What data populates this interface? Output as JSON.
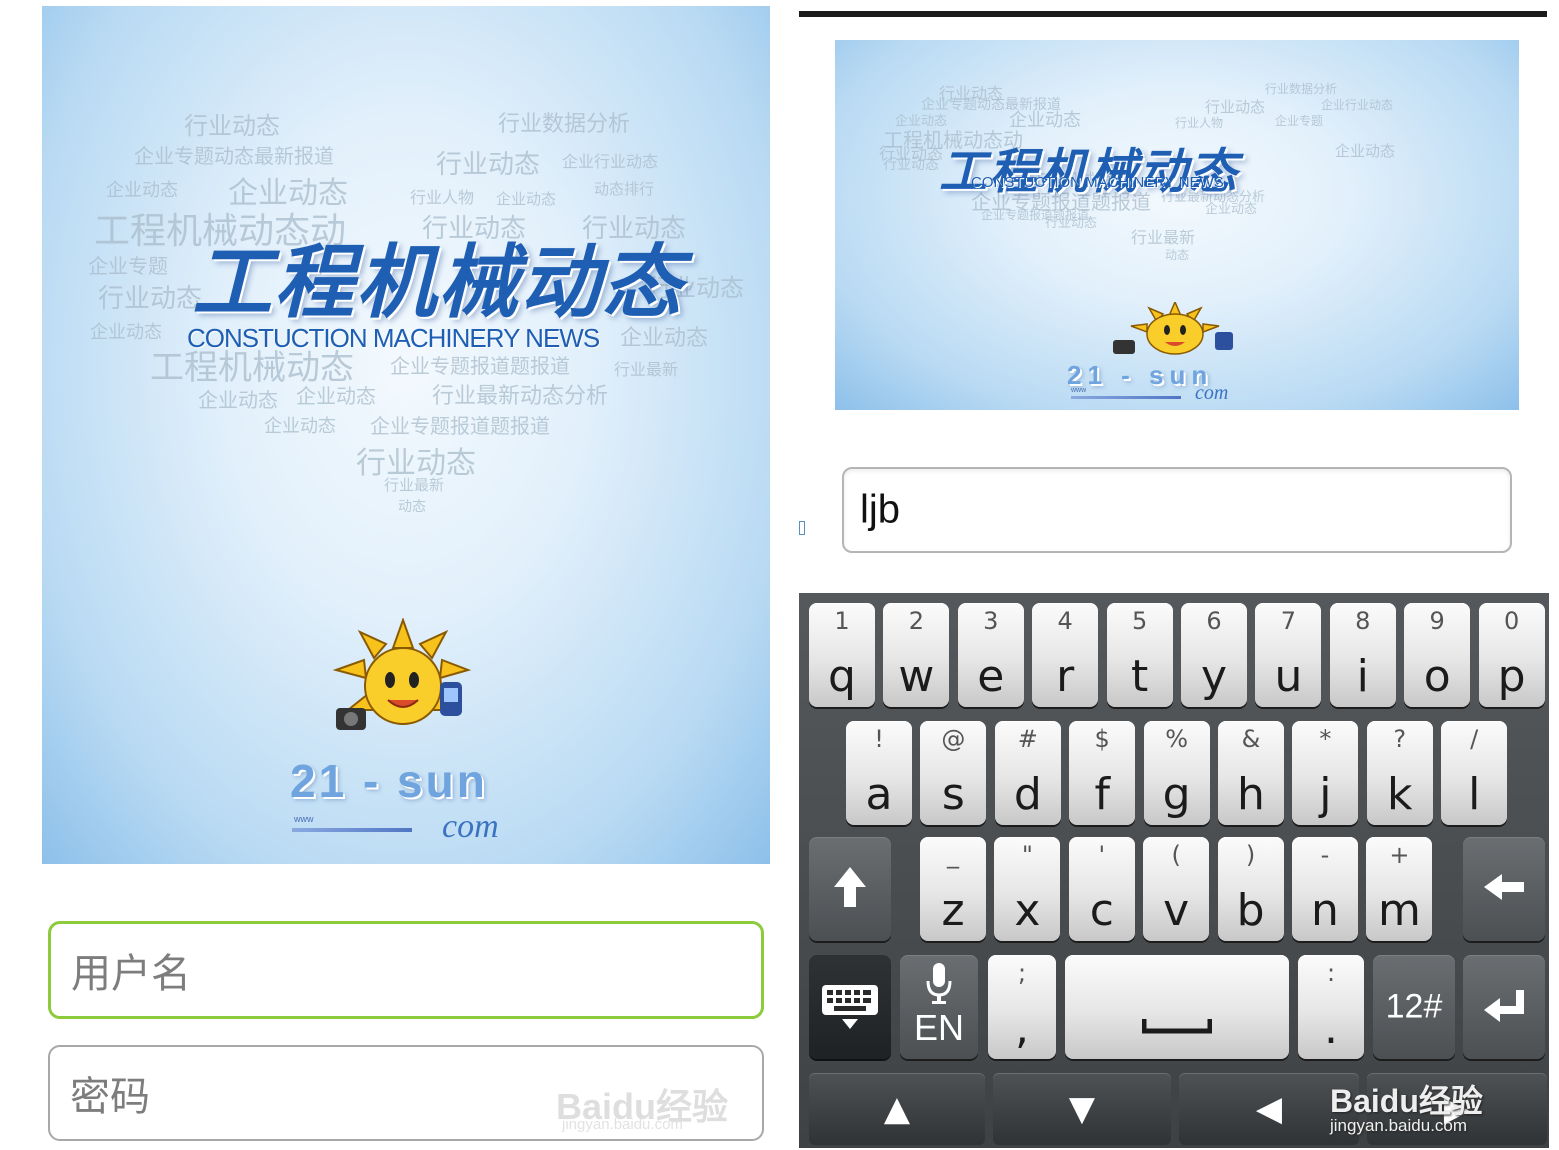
{
  "left_screen": {
    "splash": {
      "title": "工程机械动态",
      "subtitle": "CONSTUCTION MACHINERY NEWS",
      "site_name": "21 - sun",
      "site_www": "www",
      "site_tld": "com",
      "word_cloud": [
        "行业动态",
        "行业数据分析",
        "企业专题动态最新报道",
        "行业动态",
        "企业行业动态",
        "企业动态",
        "企业动态",
        "行业人物",
        "企业动态",
        "动态排行",
        "工程机械动态动",
        "行业动态",
        "行业动态",
        "企业专题",
        "行业动态",
        "行业动态",
        "企业动态",
        "企业动态",
        "工程机械动态",
        "企业专题报道题报道",
        "行业最新",
        "企业动态",
        "企业动态",
        "行业最新动态分析",
        "企业动态",
        "企业专题报道题报道",
        "行业动态",
        "行业最新",
        "动态"
      ]
    },
    "username_placeholder": "用户名",
    "password_placeholder": "密码",
    "watermark": "Baidu经验",
    "watermark_url": "jingyan.baidu.com"
  },
  "right_screen": {
    "splash": {
      "title": "工程机械动态",
      "subtitle": "CONSTUCTION MACHINERY NEWS",
      "site_name": "21 - sun",
      "site_www": "www",
      "site_tld": "com",
      "word_cloud": [
        "行业动态",
        "行业数据分析",
        "企业专题动态最新报道",
        "行业动态",
        "企业行业动态",
        "企业动态",
        "企业动态",
        "行业人物",
        "企业专题",
        "工程机械动态动",
        "行业动态",
        "企业动态",
        "行业动态",
        "工程机械动态",
        "企业专题报道题报道",
        "行业最新动态分析",
        "企业动态",
        "企业专题报道题报道",
        "行业动态",
        "行业最新",
        "动态"
      ]
    },
    "input_value": "ljb",
    "keyboard": {
      "row1": [
        {
          "sec": "1",
          "pri": "q"
        },
        {
          "sec": "2",
          "pri": "w"
        },
        {
          "sec": "3",
          "pri": "e"
        },
        {
          "sec": "4",
          "pri": "r"
        },
        {
          "sec": "5",
          "pri": "t"
        },
        {
          "sec": "6",
          "pri": "y"
        },
        {
          "sec": "7",
          "pri": "u"
        },
        {
          "sec": "8",
          "pri": "i"
        },
        {
          "sec": "9",
          "pri": "o"
        },
        {
          "sec": "0",
          "pri": "p"
        }
      ],
      "row2": [
        {
          "sec": "!",
          "pri": "a"
        },
        {
          "sec": "@",
          "pri": "s"
        },
        {
          "sec": "#",
          "pri": "d"
        },
        {
          "sec": "$",
          "pri": "f"
        },
        {
          "sec": "%",
          "pri": "g"
        },
        {
          "sec": "&",
          "pri": "h"
        },
        {
          "sec": "*",
          "pri": "j"
        },
        {
          "sec": "?",
          "pri": "k"
        },
        {
          "sec": "/",
          "pri": "l"
        }
      ],
      "row3": [
        {
          "sec": "_",
          "pri": "z"
        },
        {
          "sec": "\"",
          "pri": "x"
        },
        {
          "sec": "'",
          "pri": "c"
        },
        {
          "sec": "(",
          "pri": "v"
        },
        {
          "sec": ")",
          "pri": "b"
        },
        {
          "sec": "-",
          "pri": "n"
        },
        {
          "sec": "+",
          "pri": "m"
        }
      ],
      "shift_icon": "up-arrow-icon",
      "backspace_icon": "left-arrow-icon",
      "keyboard_switch_icon": "keyboard-icon",
      "lang_label": "EN",
      "mic_icon": "microphone-icon",
      "semicolon_sec": ";",
      "comma_pri": ",",
      "space_icon": "space-bar-icon",
      "colon_sec": ":",
      "period_pri": ".",
      "symbols_label": "12#",
      "enter_icon": "enter-arrow-icon"
    },
    "nav": {
      "up": "▲",
      "down": "▼",
      "left": "◀",
      "right": "▶"
    },
    "watermark": "Baidu经验",
    "watermark_url": "jingyan.baidu.com"
  }
}
